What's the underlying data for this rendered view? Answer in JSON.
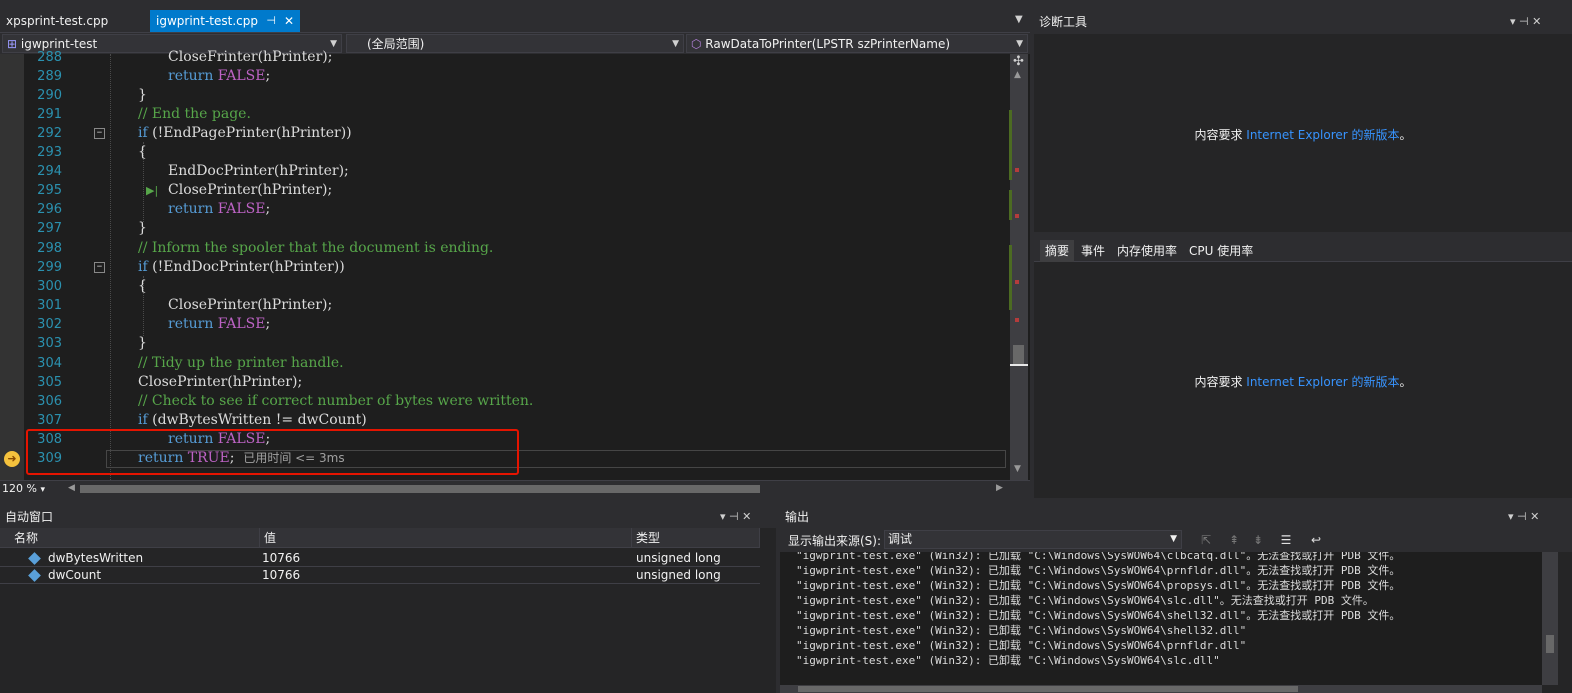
{
  "editor": {
    "tabs": [
      {
        "label": "xpsprint-test.cpp",
        "active": false
      },
      {
        "label": "igwprint-test.cpp",
        "active": true
      }
    ],
    "tab_pin": "⊣",
    "tab_close": "✕",
    "nav": {
      "project": "igwprint-test",
      "scope": "(全局范围)",
      "member": "RawDataToPrinter(LPSTR szPrinterName)"
    },
    "zoom": "120 %",
    "lines": [
      {
        "num": "288",
        "text": "CloseFrinter(hPrinter);"
      },
      {
        "num": "289",
        "kw": "return ",
        "macro": "FALSE",
        "rest": ";"
      },
      {
        "num": "290",
        "text": "}"
      },
      {
        "num": "291",
        "comment": "// End the page."
      },
      {
        "num": "292",
        "kw": "if",
        "text": " (!EndPagePrinter(hPrinter))"
      },
      {
        "num": "293",
        "text": "{"
      },
      {
        "num": "294",
        "text": "EndDocPrinter(hPrinter);"
      },
      {
        "num": "295",
        "text": "ClosePrinter(hPrinter);"
      },
      {
        "num": "296",
        "kw": "return ",
        "macro": "FALSE",
        "rest": ";"
      },
      {
        "num": "297",
        "text": "}"
      },
      {
        "num": "298",
        "comment": "// Inform the spooler that the document is ending."
      },
      {
        "num": "299",
        "kw": "if",
        "text": " (!EndDocPrinter(hPrinter))"
      },
      {
        "num": "300",
        "text": "{"
      },
      {
        "num": "301",
        "text": "ClosePrinter(hPrinter);"
      },
      {
        "num": "302",
        "kw": "return ",
        "macro": "FALSE",
        "rest": ";"
      },
      {
        "num": "303",
        "text": "}"
      },
      {
        "num": "304",
        "comment": "// Tidy up the printer handle."
      },
      {
        "num": "305",
        "text": "ClosePrinter(hPrinter);"
      },
      {
        "num": "306",
        "comment": "// Check to see if correct number of bytes were written."
      },
      {
        "num": "307",
        "kw": "if",
        "text": " (dwBytesWritten != dwCount)"
      },
      {
        "num": "308",
        "kw": "return ",
        "macro": "FALSE",
        "rest": ";"
      },
      {
        "num": "309",
        "kw": "return ",
        "macro": "TRUE",
        "rest": ";",
        "hint": "已用时间 <= 3ms"
      }
    ]
  },
  "diag": {
    "title": "诊断工具",
    "message_prefix": "内容要求 ",
    "message_link": "Internet Explorer 的新版本",
    "message_suffix": "。",
    "tabs": [
      "摘要",
      "事件",
      "内存使用率",
      "CPU 使用率"
    ]
  },
  "pane_buttons": "▾  ⊣  ✕",
  "autos": {
    "title": "自动窗口",
    "columns": [
      "名称",
      "值",
      "类型"
    ],
    "rows": [
      {
        "name": "dwBytesWritten",
        "value": "10766",
        "type": "unsigned long"
      },
      {
        "name": "dwCount",
        "value": "10766",
        "type": "unsigned long"
      }
    ]
  },
  "output": {
    "title": "输出",
    "source_label": "显示输出来源(S):",
    "source_value": "调试",
    "lines": [
      "\"igwprint-test.exe\" (Win32): 已加载 \"C:\\Windows\\SysWOW64\\clbcatq.dll\"。无法查找或打开 PDB 文件。",
      "\"igwprint-test.exe\" (Win32): 已加载 \"C:\\Windows\\SysWOW64\\prnfldr.dll\"。无法查找或打开 PDB 文件。",
      "\"igwprint-test.exe\" (Win32): 已加载 \"C:\\Windows\\SysWOW64\\propsys.dll\"。无法查找或打开 PDB 文件。",
      "\"igwprint-test.exe\" (Win32): 已加载 \"C:\\Windows\\SysWOW64\\slc.dll\"。无法查找或打开 PDB 文件。",
      "\"igwprint-test.exe\" (Win32): 已加载 \"C:\\Windows\\SysWOW64\\shell32.dll\"。无法查找或打开 PDB 文件。",
      "\"igwprint-test.exe\" (Win32): 已卸载 \"C:\\Windows\\SysWOW64\\shell32.dll\"",
      "\"igwprint-test.exe\" (Win32): 已卸载 \"C:\\Windows\\SysWOW64\\prnfldr.dll\"",
      "\"igwprint-test.exe\" (Win32): 已卸载 \"C:\\Windows\\SysWOW64\\slc.dll\""
    ]
  },
  "colors": {
    "accent": "#007acc",
    "highlight_box": "#e51400",
    "comment": "#57a64a",
    "keyword": "#569cd6",
    "macro": "#bd63c5",
    "line_number": "#2b91af"
  }
}
